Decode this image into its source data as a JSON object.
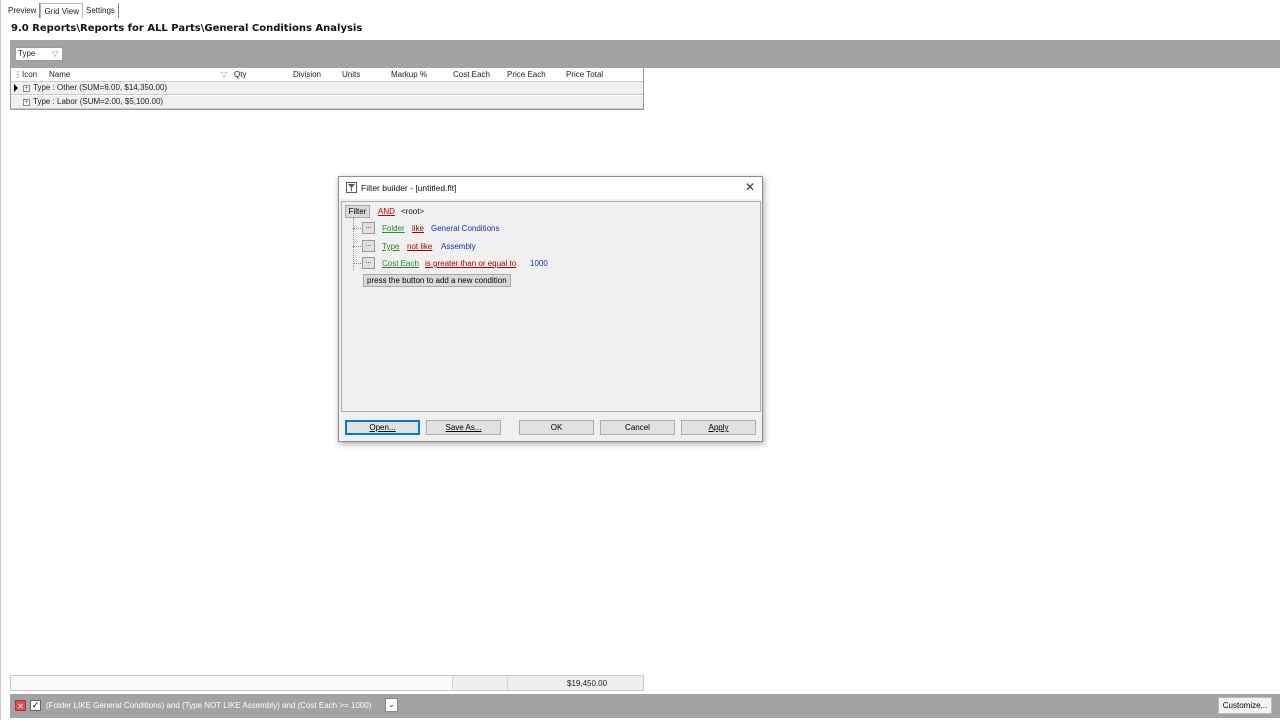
{
  "tabs": [
    {
      "label": "Preview"
    },
    {
      "label": "Grid View"
    },
    {
      "label": "Settings"
    }
  ],
  "report_title": "9.0 Reports\\Reports for ALL Parts\\General Conditions Analysis",
  "group_panel": {
    "chip_label": "Type"
  },
  "grid": {
    "columns": [
      "Icon",
      "Name",
      "Qty",
      "Division",
      "Units",
      "Markup %",
      "Cost Each",
      "Price Each",
      "Price Total"
    ],
    "group_rows": [
      {
        "label": "Type : Other (SUM=6.00, $14,350.00)"
      },
      {
        "label": "Type : Labor (SUM=2.00, $5,100.00)"
      }
    ],
    "footer_total": "$19,450.00"
  },
  "filter_bar": {
    "expression": "(Folder LIKE General Conditions) and (Type NOT LIKE Assembly) and (Cost Each >= 1000)",
    "customize_label": "Customize..."
  },
  "dialog": {
    "title": "Filter builder - [untitled.flt]",
    "filter_label": "Filter",
    "group_operator": "AND",
    "root_label": "<root>",
    "conditions": [
      {
        "field": "Folder",
        "operator": "like",
        "value": "General Conditions"
      },
      {
        "field": "Type",
        "operator": "not like",
        "value": "Assembly"
      },
      {
        "field": "Cost Each",
        "operator": "is greater than or equal to",
        "value": "1000"
      }
    ],
    "add_condition_label": "press the button to add a new condition",
    "buttons": {
      "open": "Open...",
      "save_as": "Save As...",
      "ok": "OK",
      "cancel": "Cancel",
      "apply": "Apply"
    }
  },
  "colors": {
    "band_gray": "#a3a3a3",
    "field_green": "#2a8a2a",
    "operator_red": "#b00000",
    "value_blue": "#2030b0"
  }
}
